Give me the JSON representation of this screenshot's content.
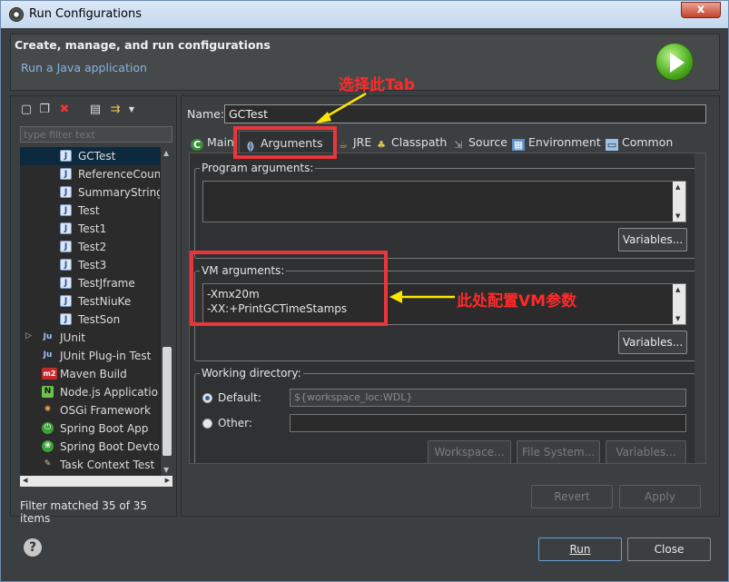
{
  "window": {
    "title": "Run Configurations",
    "close_label": "x"
  },
  "header": {
    "title": "Create, manage, and run configurations",
    "subtitle": "Run a Java application"
  },
  "left": {
    "filter_placeholder": "type filter text",
    "tree": [
      {
        "label": "GCTest",
        "icon": "java-class-icon",
        "selected": true
      },
      {
        "label": "ReferenceCoun",
        "icon": "java-class-icon"
      },
      {
        "label": "SummaryString",
        "icon": "java-class-icon"
      },
      {
        "label": "Test",
        "icon": "java-class-icon"
      },
      {
        "label": "Test1",
        "icon": "java-class-icon"
      },
      {
        "label": "Test2",
        "icon": "java-class-icon"
      },
      {
        "label": "Test3",
        "icon": "java-class-icon"
      },
      {
        "label": "TestJframe",
        "icon": "java-class-icon"
      },
      {
        "label": "TestNiuKe",
        "icon": "java-class-icon"
      },
      {
        "label": "TestSon",
        "icon": "java-class-icon"
      },
      {
        "label": "JUnit",
        "icon": "junit-icon"
      },
      {
        "label": "JUnit Plug-in Test",
        "icon": "junit-plugin-icon"
      },
      {
        "label": "Maven Build",
        "icon": "maven-icon"
      },
      {
        "label": "Node.js Applicatio",
        "icon": "nodejs-icon"
      },
      {
        "label": "OSGi Framework",
        "icon": "osgi-icon"
      },
      {
        "label": "Spring Boot App",
        "icon": "spring-boot-icon"
      },
      {
        "label": "Spring Boot Devto",
        "icon": "spring-devtools-icon"
      },
      {
        "label": "Task Context Test",
        "icon": "task-context-icon"
      }
    ],
    "status": "Filter matched 35 of 35 items"
  },
  "right": {
    "name_label": "Name:",
    "name_value": "GCTest",
    "tabs": [
      "Main",
      "Arguments",
      "JRE",
      "Classpath",
      "Source",
      "Environment",
      "Common"
    ],
    "active_tab": "Arguments",
    "program_args_label": "Program arguments:",
    "program_args_value": "",
    "variables_label": "Variables...",
    "vm_args_label": "VM arguments:",
    "vm_args_lines": [
      "-Xmx20m",
      "-XX:+PrintGCTimeStamps"
    ],
    "working_dir_label": "Working directory:",
    "default_label": "Default:",
    "default_value": "${workspace_loc:WDL}",
    "other_label": "Other:",
    "other_value": "",
    "workspace_btn": "Workspace...",
    "filesystem_btn": "File System...",
    "variables_btn_dir": "Variables...",
    "revert_label": "Revert",
    "apply_label": "Apply"
  },
  "footer": {
    "run_label": "Run",
    "close_label": "Close",
    "help_label": "?"
  },
  "annotations": {
    "tab_note": "选择此Tab",
    "vm_note": "此处配置VM参数",
    "color": "#e8363a",
    "arrow_color": "#ffe600"
  }
}
